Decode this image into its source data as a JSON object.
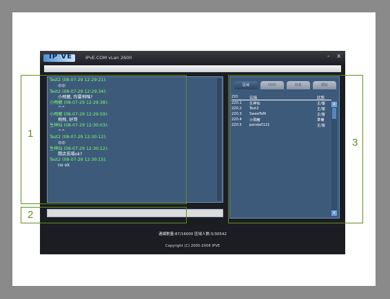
{
  "window": {
    "logo_text": "IP VE",
    "title": "IPvE.COM vLan 2600",
    "minimize_label": "-",
    "close_label": "x"
  },
  "chat": {
    "messages": [
      {
        "header": "Test2 (08-07-29 12:29:21):",
        "body": "◎◎"
      },
      {
        "header": "Test2 (08-07-29 12:29:34):",
        "body": "小飛豬, 你要飛嗎?"
      },
      {
        "header": "小飛豬 (08-07-29 12:29:38):",
        "body": "^^"
      },
      {
        "header": "小飛豬 (08-07-29 12:29:59):",
        "body": "飛飛, 好哥"
      },
      {
        "header": "生神仙 (08-07-29 12:30:03):",
        "body": "^^"
      },
      {
        "header": "Test2 (08-07-29 12:30:12):",
        "body": "◎◎"
      },
      {
        "header": "生神仙 (08-07-29 12:30:12):",
        "body": "開店長場ok?"
      },
      {
        "header": "Test2 (08-07-29 12:30:15):",
        "body": "no ok"
      }
    ]
  },
  "input": {
    "value": ""
  },
  "users": {
    "tabs": [
      "區域",
      "ODD",
      "好友",
      "朋友"
    ],
    "columns": {
      "id": "ZID",
      "name": "名稱",
      "status": "狀態"
    },
    "rows": [
      {
        "id": "220.1",
        "name": "生神仙",
        "status": "主/客"
      },
      {
        "id": "220.2",
        "name": "Test2",
        "status": "主/客"
      },
      {
        "id": "220.3",
        "name": "SweeToM",
        "status": "主/客"
      },
      {
        "id": "220.4",
        "name": "小飛豬",
        "status": "準備"
      },
      {
        "id": "220.5",
        "name": "panda0121",
        "status": "主/客"
      }
    ],
    "scroll_up": "∧",
    "scroll_down": "∨"
  },
  "status_bar": {
    "text": "連線數量:87/16000   區域人數:5/30542"
  },
  "footer": {
    "copyright": "Copyright (C) 2005-2008 IPVE"
  },
  "annotations": {
    "labels": [
      "1",
      "2",
      "3"
    ]
  }
}
